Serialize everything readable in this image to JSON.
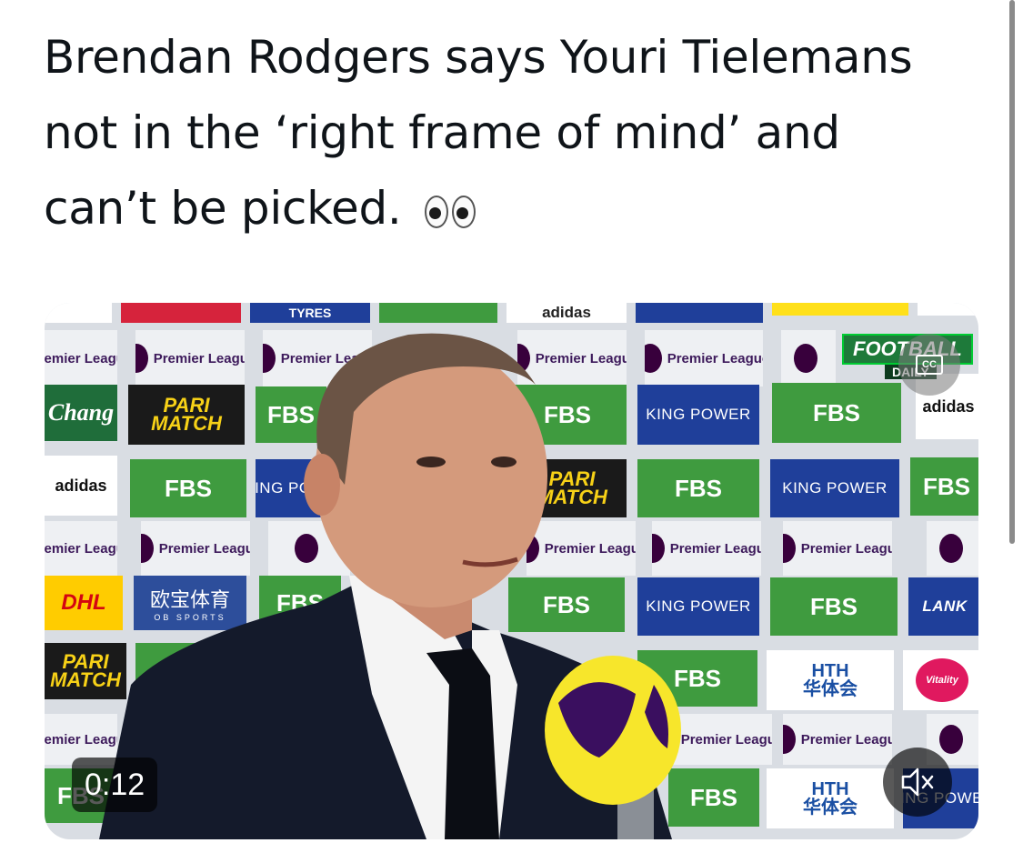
{
  "tweet": {
    "text": "Brendan Rodgers says Youri Tielemans not in the ‘right frame of mind’ and can’t be picked.",
    "emoji": "eyes"
  },
  "video": {
    "timestamp": "0:12",
    "overlay_logo_top": "FOOTBALL",
    "overlay_logo_bottom": "DAILY",
    "cc_label": "CC",
    "mic_color": "#f7e62b"
  },
  "board": {
    "premier_league": "Premier\nLeague",
    "fbs": "FBS",
    "king_power": "KING POWER",
    "pari_match": "PARI\nMATCH",
    "dhl": "DHL",
    "ob_sports": "欧宝体育",
    "ob_sports_sub": "OB SPORTS",
    "hth": "HTH\n华体会",
    "vitality": "Vitality",
    "adidas": "adidas",
    "chang": "Chang",
    "tyres": "TYRES",
    "lanka": "LANK"
  },
  "icons": {
    "cc": "closed-captions-icon",
    "mute": "speaker-muted-icon"
  }
}
